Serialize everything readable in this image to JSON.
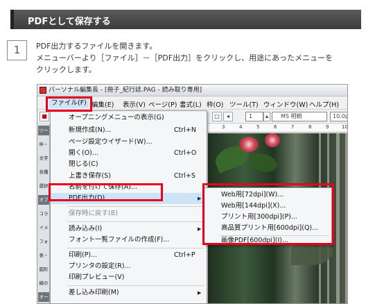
{
  "section_title": "PDFとして保存する",
  "step": {
    "number": "1",
    "lines": [
      "PDF出力するファイルを開きます。",
      "メニューバーより［ファイル］－［PDF出力］をクリックし、用途にあったメニューを",
      "クリックします。"
    ]
  },
  "window": {
    "title": "パーソナル編集長 - [冊子_紀行誌.PAG - 読み取り専用]",
    "menubar": [
      "ファイル(F)",
      "編集(E)",
      "表示(V)",
      "ページ(P)",
      "書式(L)",
      "枠(O)",
      "ツール(T)",
      "ウィンドウ(W)",
      "ヘルプ(H)"
    ],
    "toolbar": {
      "page_number": "1",
      "font_name": "MS 明朝",
      "font_size": "10.0p"
    },
    "ruler_marks": [
      "3",
      "4",
      "5",
      "6",
      "7",
      "8",
      "9",
      "10"
    ],
    "left_panel_tabs": [
      "ツー",
      "枠・",
      "文字",
      "各種",
      "選択",
      "オブ",
      "コラ",
      "イメ",
      "フォ",
      "表・",
      "図形",
      "線の",
      "オー"
    ]
  },
  "file_menu": [
    {
      "label": "オープニングメニューの表示(G)",
      "shortcut": ""
    },
    {
      "label": "新規作成(N)...",
      "shortcut": "Ctrl+N"
    },
    {
      "label": "ページ設定ウイザード(W)...",
      "shortcut": ""
    },
    {
      "label": "開く(O)...",
      "shortcut": "Ctrl+O"
    },
    {
      "label": "閉じる(C)",
      "shortcut": ""
    },
    {
      "label": "上書き保存(S)",
      "shortcut": "Ctrl+S"
    },
    {
      "label": "名前を付けて保存(A)...",
      "shortcut": ""
    },
    {
      "label": "PDF出力(D)",
      "shortcut": ""
    },
    {
      "label": "保存時に戻す(B)",
      "shortcut": ""
    },
    {
      "label": "読み込み(I)",
      "shortcut": ""
    },
    {
      "label": "フォント一覧ファイルの作成(F)...",
      "shortcut": ""
    },
    {
      "label": "印刷(P)...",
      "shortcut": "Ctrl+P"
    },
    {
      "label": "プリンタの設定(R)...",
      "shortcut": ""
    },
    {
      "label": "印刷プレビュー(V)",
      "shortcut": ""
    },
    {
      "label": "差し込み印刷(M)",
      "shortcut": ""
    }
  ],
  "pdf_submenu": [
    "Web用[72dpi](W)...",
    "Web用[144dpi](X)...",
    "プリント用[300dpi](P)...",
    "高品質プリント用[600dpi](Q)...",
    "画像PDF[600dpi](I)..."
  ],
  "colors": {
    "highlight_red": "#e8001c",
    "menu_highlight": "#cde4f7",
    "header_bg": "#444444"
  }
}
